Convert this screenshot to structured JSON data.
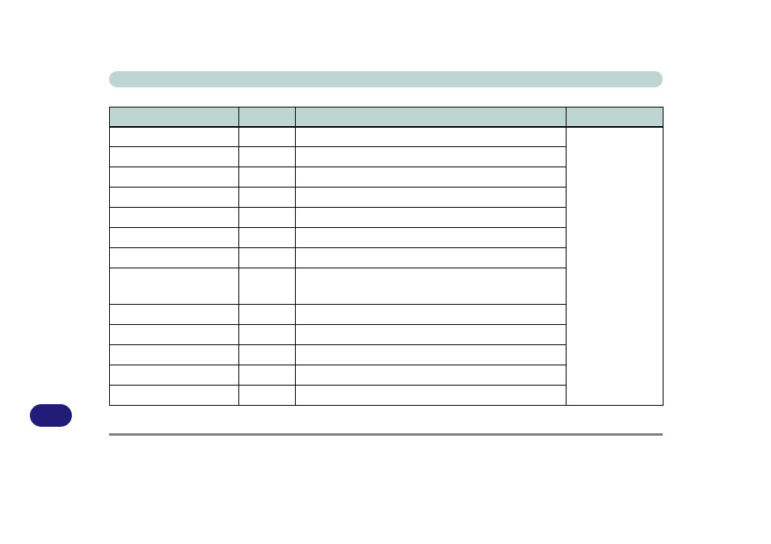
{
  "header": {
    "title": ""
  },
  "table": {
    "columns": {
      "c1": "",
      "c2": "",
      "c3": "",
      "c4": ""
    },
    "rows": [
      {
        "c1": "",
        "c2": "",
        "c3": "",
        "tall": false
      },
      {
        "c1": "",
        "c2": "",
        "c3": "",
        "tall": false
      },
      {
        "c1": "",
        "c2": "",
        "c3": "",
        "tall": false
      },
      {
        "c1": "",
        "c2": "",
        "c3": "",
        "tall": false
      },
      {
        "c1": "",
        "c2": "",
        "c3": "",
        "tall": false
      },
      {
        "c1": "",
        "c2": "",
        "c3": "",
        "tall": false
      },
      {
        "c1": "",
        "c2": "",
        "c3": "",
        "tall": false
      },
      {
        "c1": "",
        "c2": "",
        "c3": "",
        "tall": true
      },
      {
        "c1": "",
        "c2": "",
        "c3": "",
        "tall": false
      },
      {
        "c1": "",
        "c2": "",
        "c3": "",
        "tall": false
      },
      {
        "c1": "",
        "c2": "",
        "c3": "",
        "tall": false
      },
      {
        "c1": "",
        "c2": "",
        "c3": "",
        "tall": false
      },
      {
        "c1": "",
        "c2": "",
        "c3": "",
        "tall": false
      }
    ],
    "notes": ""
  },
  "page": {
    "number": ""
  },
  "colors": {
    "band": "#bed6d1",
    "badge": "#221c79",
    "rule": "#7e7e7e"
  }
}
